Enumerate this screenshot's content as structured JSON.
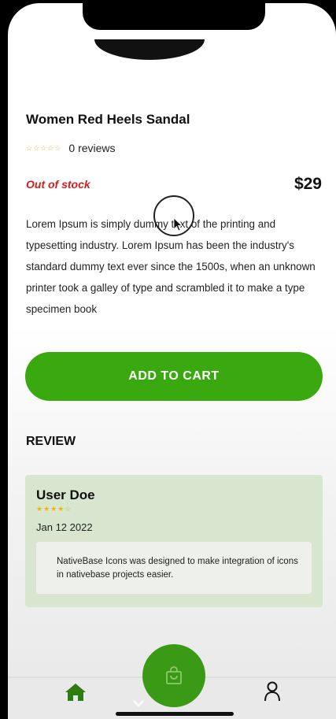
{
  "product": {
    "title": "Women Red Heels Sandal",
    "rating": 0,
    "reviews_label": "0 reviews",
    "stock_status": "Out of stock",
    "price": "$29",
    "description": "Lorem Ipsum is simply dummy text of the printing and typesetting industry. Lorem Ipsum has been the industry's standard dummy text ever since the 1500s, when an unknown printer took a galley of type and scrambled it to make a type specimen book"
  },
  "actions": {
    "add_to_cart_label": "ADD TO CART"
  },
  "review_section": {
    "heading": "REVIEW",
    "reviews": [
      {
        "user": "User Doe",
        "rating": 4,
        "max_rating": 5,
        "date": "Jan 12 2022",
        "comment": "NativeBase Icons was designed to make integration of icons in nativebase projects easier."
      }
    ]
  },
  "tab_bar": {
    "items": [
      {
        "icon": "home-icon",
        "active": true
      },
      {
        "icon": "shopping-bag-icon",
        "active": false
      },
      {
        "icon": "user-icon",
        "active": false
      }
    ]
  },
  "colors": {
    "accent_green": "#3aa80f",
    "out_of_stock_red": "#d31c1c",
    "star_gold": "#f2b600",
    "review_card_bg": "#d8e6cf"
  }
}
